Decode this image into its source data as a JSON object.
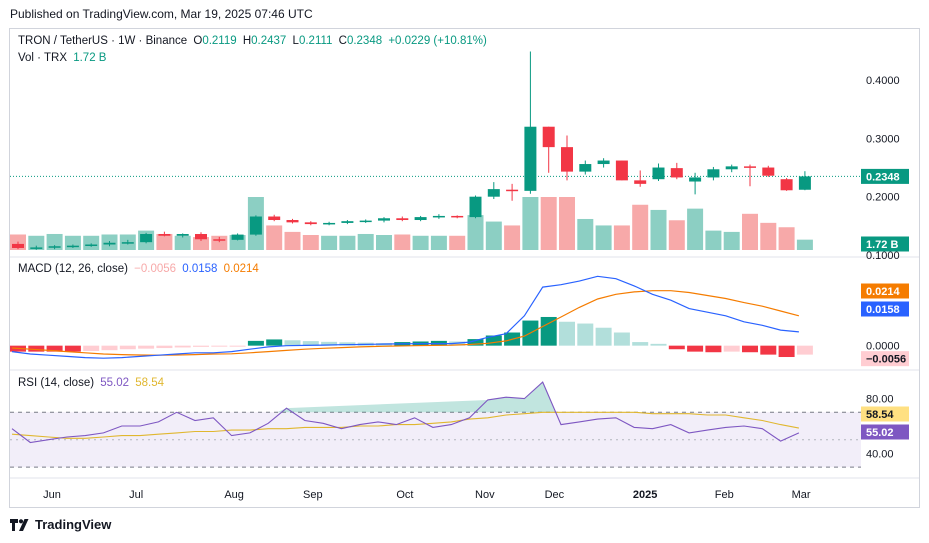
{
  "header": {
    "published": "Published on TradingView.com, Mar 19, 2025 07:46 UTC"
  },
  "footer": {
    "brand": "TradingView",
    "logo_icon": "tradingview-logo-icon"
  },
  "legend": {
    "symbol": "TRON / TetherUS · 1W · Binance",
    "o_label": "O",
    "o_value": "0.2119",
    "h_label": "H",
    "h_value": "0.2437",
    "l_label": "L",
    "l_value": "0.2111",
    "c_label": "C",
    "c_value": "0.2348",
    "change": "+0.0229 (+10.81%)",
    "vol_label": "Vol · TRX",
    "vol_value": "1.72 B",
    "macd_label": "MACD (12, 26, close)",
    "macd_hist": "−0.0056",
    "macd_line": "0.0158",
    "macd_signal": "0.0214",
    "rsi_label": "RSI (14, close)",
    "rsi_value": "55.02",
    "rsi_ma": "58.54"
  },
  "colors": {
    "up": "#089981",
    "down": "#f23645",
    "vol_up": "#8ccfc3",
    "vol_down": "#f7a9a9",
    "macd": "#2962ff",
    "signal": "#f57c00",
    "rsi": "#7e57c2",
    "rsi_ma": "#e0b72f"
  },
  "chart_data": [
    {
      "type": "candlestick",
      "title": "TRON / TetherUS · 1W · Binance",
      "x_labels": [
        "Jun",
        "Jul",
        "Aug",
        "Sep",
        "Oct",
        "Nov",
        "Dec",
        "2025",
        "Feb",
        "Mar"
      ],
      "y_ticks": [
        "0.4000",
        "0.3000",
        "0.2000",
        "0.1000"
      ],
      "last_price_label": "0.2348",
      "volume_label": "1.72 B",
      "ylim": [
        0.1,
        0.455
      ],
      "candles": [
        {
          "o": 0.119,
          "h": 0.123,
          "l": 0.11,
          "c": 0.112
        },
        {
          "o": 0.112,
          "h": 0.116,
          "l": 0.109,
          "c": 0.113
        },
        {
          "o": 0.113,
          "h": 0.117,
          "l": 0.11,
          "c": 0.115
        },
        {
          "o": 0.115,
          "h": 0.118,
          "l": 0.112,
          "c": 0.116
        },
        {
          "o": 0.116,
          "h": 0.12,
          "l": 0.114,
          "c": 0.118
        },
        {
          "o": 0.118,
          "h": 0.124,
          "l": 0.115,
          "c": 0.121
        },
        {
          "o": 0.121,
          "h": 0.126,
          "l": 0.118,
          "c": 0.122
        },
        {
          "o": 0.122,
          "h": 0.138,
          "l": 0.12,
          "c": 0.136
        },
        {
          "o": 0.136,
          "h": 0.14,
          "l": 0.132,
          "c": 0.133
        },
        {
          "o": 0.133,
          "h": 0.137,
          "l": 0.13,
          "c": 0.136
        },
        {
          "o": 0.136,
          "h": 0.139,
          "l": 0.124,
          "c": 0.127
        },
        {
          "o": 0.127,
          "h": 0.131,
          "l": 0.122,
          "c": 0.126
        },
        {
          "o": 0.126,
          "h": 0.137,
          "l": 0.125,
          "c": 0.135
        },
        {
          "o": 0.135,
          "h": 0.168,
          "l": 0.133,
          "c": 0.166
        },
        {
          "o": 0.166,
          "h": 0.169,
          "l": 0.158,
          "c": 0.16
        },
        {
          "o": 0.16,
          "h": 0.162,
          "l": 0.154,
          "c": 0.156
        },
        {
          "o": 0.156,
          "h": 0.158,
          "l": 0.151,
          "c": 0.153
        },
        {
          "o": 0.153,
          "h": 0.157,
          "l": 0.151,
          "c": 0.155
        },
        {
          "o": 0.155,
          "h": 0.16,
          "l": 0.153,
          "c": 0.158
        },
        {
          "o": 0.158,
          "h": 0.161,
          "l": 0.155,
          "c": 0.159
        },
        {
          "o": 0.159,
          "h": 0.165,
          "l": 0.156,
          "c": 0.163
        },
        {
          "o": 0.163,
          "h": 0.166,
          "l": 0.158,
          "c": 0.16
        },
        {
          "o": 0.16,
          "h": 0.167,
          "l": 0.158,
          "c": 0.165
        },
        {
          "o": 0.165,
          "h": 0.17,
          "l": 0.162,
          "c": 0.167
        },
        {
          "o": 0.167,
          "h": 0.168,
          "l": 0.163,
          "c": 0.165
        },
        {
          "o": 0.165,
          "h": 0.202,
          "l": 0.163,
          "c": 0.2
        },
        {
          "o": 0.2,
          "h": 0.225,
          "l": 0.196,
          "c": 0.213
        },
        {
          "o": 0.212,
          "h": 0.222,
          "l": 0.193,
          "c": 0.21
        },
        {
          "o": 0.21,
          "h": 0.449,
          "l": 0.205,
          "c": 0.32
        },
        {
          "o": 0.32,
          "h": 0.32,
          "l": 0.241,
          "c": 0.285
        },
        {
          "o": 0.285,
          "h": 0.305,
          "l": 0.228,
          "c": 0.243
        },
        {
          "o": 0.243,
          "h": 0.262,
          "l": 0.238,
          "c": 0.256
        },
        {
          "o": 0.256,
          "h": 0.266,
          "l": 0.25,
          "c": 0.262
        },
        {
          "o": 0.262,
          "h": 0.262,
          "l": 0.228,
          "c": 0.228
        },
        {
          "o": 0.228,
          "h": 0.245,
          "l": 0.217,
          "c": 0.222
        },
        {
          "o": 0.23,
          "h": 0.257,
          "l": 0.227,
          "c": 0.25
        },
        {
          "o": 0.249,
          "h": 0.258,
          "l": 0.23,
          "c": 0.233
        },
        {
          "o": 0.226,
          "h": 0.241,
          "l": 0.204,
          "c": 0.233
        },
        {
          "o": 0.233,
          "h": 0.251,
          "l": 0.228,
          "c": 0.247
        },
        {
          "o": 0.247,
          "h": 0.255,
          "l": 0.242,
          "c": 0.252
        },
        {
          "o": 0.252,
          "h": 0.255,
          "l": 0.218,
          "c": 0.25
        },
        {
          "o": 0.25,
          "h": 0.253,
          "l": 0.234,
          "c": 0.236
        },
        {
          "o": 0.23,
          "h": 0.232,
          "l": 0.21,
          "c": 0.211
        },
        {
          "o": 0.2119,
          "h": 0.2437,
          "l": 0.2111,
          "c": 0.2348
        }
      ],
      "volume": [
        0.6,
        0.55,
        0.62,
        0.55,
        0.55,
        0.6,
        0.6,
        0.75,
        0.62,
        0.55,
        0.5,
        0.55,
        0.58,
        2.05,
        0.95,
        0.7,
        0.58,
        0.55,
        0.55,
        0.62,
        0.58,
        0.6,
        0.55,
        0.55,
        0.55,
        1.35,
        1.1,
        0.95,
        2.05,
        2.05,
        2.05,
        1.2,
        0.95,
        0.95,
        1.75,
        1.55,
        1.15,
        1.6,
        0.75,
        0.7,
        1.4,
        1.05,
        0.88,
        0.4
      ]
    },
    {
      "type": "bar_and_line",
      "title": "MACD (12, 26, close)",
      "y_ticks": [
        "0.0000"
      ],
      "ylim": [
        -0.012,
        0.07
      ],
      "macd_label": "0.0158",
      "signal_label": "0.0214",
      "hist_label": "−0.0056",
      "macd": [
        -0.005,
        -0.007,
        -0.008,
        -0.009,
        -0.01,
        -0.0105,
        -0.01,
        -0.009,
        -0.008,
        -0.007,
        -0.006,
        -0.006,
        -0.005,
        -0.003,
        -0.001,
        0.0,
        0.0002,
        0.0005,
        0.0008,
        0.001,
        0.0012,
        0.0015,
        0.0016,
        0.0017,
        0.0017,
        0.003,
        0.007,
        0.01,
        0.025,
        0.049,
        0.051,
        0.054,
        0.058,
        0.056,
        0.05,
        0.043,
        0.038,
        0.031,
        0.028,
        0.025,
        0.02,
        0.017,
        0.013,
        0.0115
      ],
      "signal": [
        -0.002,
        -0.003,
        -0.004,
        -0.005,
        -0.006,
        -0.007,
        -0.0075,
        -0.0078,
        -0.008,
        -0.0078,
        -0.0075,
        -0.007,
        -0.0068,
        -0.006,
        -0.005,
        -0.004,
        -0.003,
        -0.0022,
        -0.0016,
        -0.001,
        -0.0006,
        -0.0003,
        0.0,
        0.0002,
        0.0004,
        0.001,
        0.002,
        0.004,
        0.008,
        0.016,
        0.024,
        0.032,
        0.039,
        0.043,
        0.045,
        0.046,
        0.046,
        0.0445,
        0.042,
        0.0395,
        0.036,
        0.033,
        0.029,
        0.025
      ],
      "hist": [
        -0.005,
        -0.005,
        -0.005,
        -0.005,
        -0.0045,
        -0.0038,
        -0.003,
        -0.0025,
        -0.002,
        -0.0015,
        -0.001,
        -0.0008,
        -0.0005,
        0.004,
        0.0052,
        0.0045,
        0.0038,
        0.0032,
        0.0028,
        0.0025,
        0.0022,
        0.003,
        0.0035,
        0.004,
        0.0035,
        0.0055,
        0.0085,
        0.011,
        0.021,
        0.024,
        0.02,
        0.0185,
        0.015,
        0.011,
        0.003,
        0.0015,
        -0.003,
        -0.005,
        -0.0055,
        -0.005,
        -0.0055,
        -0.0075,
        -0.0095,
        -0.0075
      ]
    },
    {
      "type": "line",
      "title": "RSI (14, close)",
      "y_ticks": [
        "80.00",
        "40.00"
      ],
      "ylim": [
        25,
        95
      ],
      "band": [
        30,
        70
      ],
      "rsi_label": "55.02",
      "ma_label": "58.54",
      "rsi": [
        58,
        48,
        50,
        52,
        53,
        55,
        60,
        60,
        63,
        70,
        64,
        66,
        53,
        55,
        62,
        73,
        64,
        62,
        58,
        61,
        63,
        61,
        66,
        59,
        61,
        66,
        79,
        81,
        80,
        92,
        61,
        63,
        65,
        66,
        59,
        58,
        61,
        55,
        57,
        59,
        60,
        58,
        49,
        55
      ],
      "rsi_ma": [
        54,
        53,
        52,
        51,
        51,
        52,
        53,
        53,
        54,
        55,
        56,
        56,
        57,
        57,
        58,
        58,
        59,
        59,
        59,
        60,
        60,
        61,
        61,
        62,
        63,
        65,
        66,
        68,
        69,
        70,
        70,
        70,
        70,
        70,
        70,
        69,
        69,
        69,
        68,
        68,
        66,
        64,
        61,
        58.5
      ]
    }
  ]
}
